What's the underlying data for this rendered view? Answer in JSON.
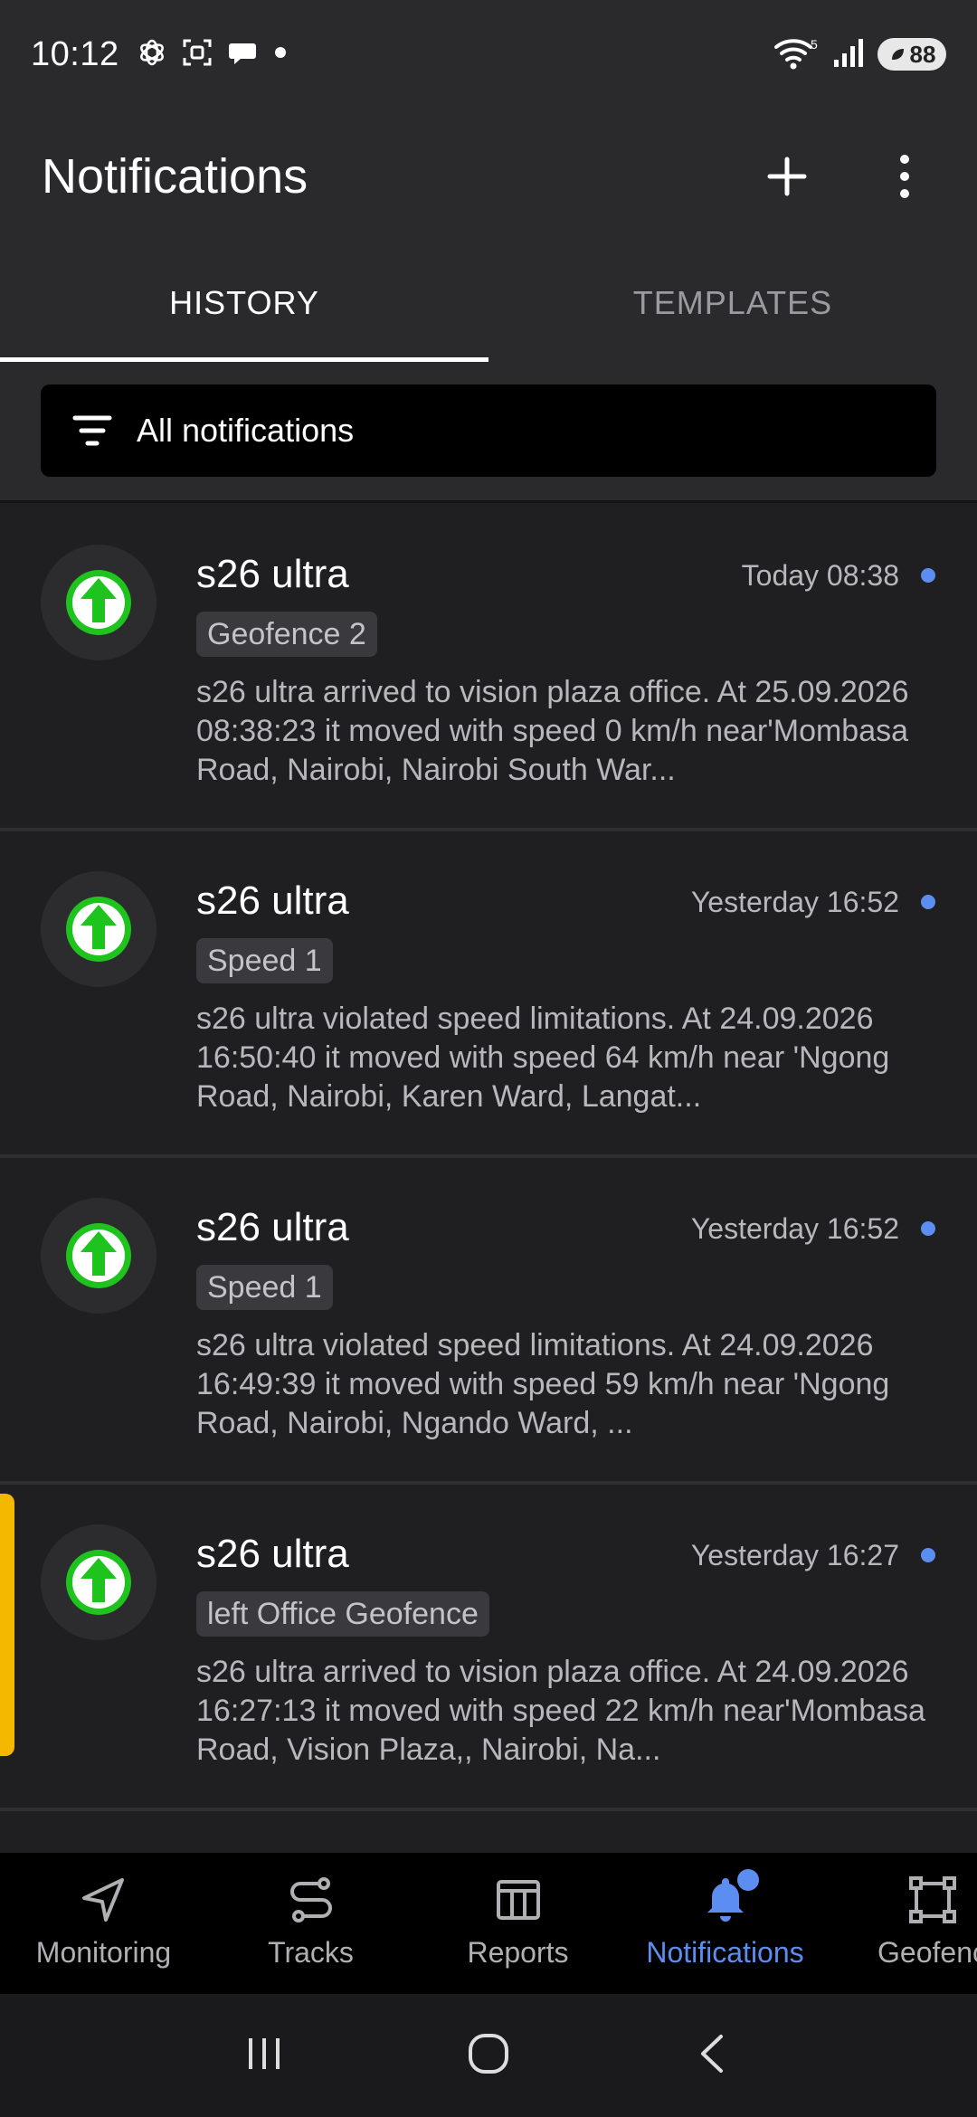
{
  "status_bar": {
    "time": "10:12",
    "battery": "88",
    "icons": [
      "chatgpt-icon",
      "screenshot-icon",
      "messages-icon",
      "dot-icon",
      "wifi-icon",
      "signal-icon",
      "battery-icon"
    ]
  },
  "app_bar": {
    "title": "Notifications",
    "actions": [
      "add-icon",
      "more-vert-icon"
    ]
  },
  "tabs": [
    {
      "label": "HISTORY",
      "active": true
    },
    {
      "label": "TEMPLATES",
      "active": false
    }
  ],
  "filter": {
    "label": "All notifications",
    "icon": "filter-icon"
  },
  "notifications": [
    {
      "title": "s26 ultra",
      "time": "Today 08:38",
      "badge": "Geofence 2",
      "text": "s26 ultra arrived to vision plaza office. At 25.09.2026 08:38:23 it moved with speed 0 km/h near'Mombasa Road, Nairobi, Nairobi South War...",
      "unread": true
    },
    {
      "title": "s26 ultra",
      "time": "Yesterday 16:52",
      "badge": "Speed 1",
      "text": "s26 ultra violated speed limitations. At 24.09.2026 16:50:40 it moved with speed 64 km/h near 'Ngong Road, Nairobi, Karen Ward, Langat...",
      "unread": true
    },
    {
      "title": "s26 ultra",
      "time": "Yesterday 16:52",
      "badge": "Speed 1",
      "text": "s26 ultra violated speed limitations. At 24.09.2026 16:49:39 it moved with speed 59 km/h near 'Ngong Road, Nairobi, Ngando Ward, ...",
      "unread": true
    },
    {
      "title": "s26 ultra",
      "time": "Yesterday 16:27",
      "badge": "left Office Geofence",
      "text": "s26 ultra arrived to vision plaza office. At 24.09.2026 16:27:13 it moved with speed 22 km/h near'Mombasa Road, Vision Plaza,, Nairobi, Na...",
      "unread": true
    }
  ],
  "bottom_nav": [
    {
      "label": "Monitoring",
      "icon": "navigation-arrow-icon"
    },
    {
      "label": "Tracks",
      "icon": "route-icon"
    },
    {
      "label": "Reports",
      "icon": "table-icon"
    },
    {
      "label": "Notifications",
      "icon": "bell-icon"
    },
    {
      "label": "Geofenc",
      "icon": "geofence-icon"
    }
  ],
  "colors": {
    "accent": "#5b8ef0",
    "arrival_green": "#1ec31e",
    "highlight_bar": "#f5b800"
  }
}
